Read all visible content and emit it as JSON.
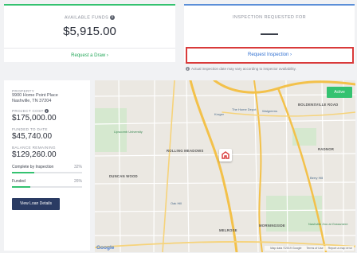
{
  "funds": {
    "label": "AVAILABLE FUNDS",
    "amount": "$5,915.00",
    "link": "Request a Draw ›"
  },
  "inspection": {
    "label": "INSPECTION REQUESTED FOR",
    "value": "—",
    "button": "Request Inspection ›",
    "note": "Actual inspection date may vary according to inspector availability."
  },
  "details": {
    "property_label": "PROPERTY",
    "address_line1": "9900 Home Point Place",
    "address_line2": "Nashville, TN 37204",
    "project_cost_label": "PROJECT COST",
    "project_cost": "$175,000.00",
    "funded_label": "FUNDED TO DATE",
    "funded": "$45,740.00",
    "balance_label": "BALANCE REMAINING",
    "balance": "$129,260.00",
    "progress": [
      {
        "label": "Complete by Inspection",
        "pct_text": "32%",
        "pct": 32
      },
      {
        "label": "Funded",
        "pct_text": "26%",
        "pct": 26
      }
    ],
    "button": "View Loan Details"
  },
  "map": {
    "status": "Active",
    "labels": [
      {
        "text": "ROLLING MEADOWS"
      },
      {
        "text": "DUNCAN WOOD"
      },
      {
        "text": "MELROSE"
      },
      {
        "text": "MORNINGSIDE"
      },
      {
        "text": "RADNOR"
      },
      {
        "text": "BOLDENSVILLE ROAD"
      }
    ],
    "places": [
      {
        "text": "Lipscomb University"
      },
      {
        "text": "Kroger"
      },
      {
        "text": "The Home Depot"
      },
      {
        "text": "Walgreens"
      },
      {
        "text": "Nashville Zoo at Grassmere"
      },
      {
        "text": "Oak Hill"
      },
      {
        "text": "Berry Hill"
      }
    ],
    "google": "Google",
    "footer": [
      "Map data ©2019 Google",
      "Terms of Use",
      "Report a map error"
    ]
  },
  "colors": {
    "accent_green": "#34c270",
    "accent_blue": "#2f6fd1",
    "highlight_red": "#d93a3a",
    "button_navy": "#2a3b63"
  }
}
